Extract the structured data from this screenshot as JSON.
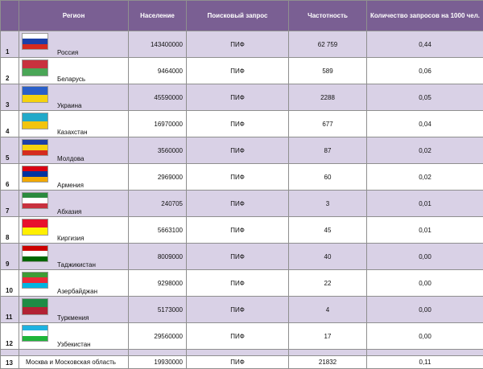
{
  "headers": {
    "num": "",
    "region": "Регион",
    "population": "Население",
    "query": "Поисковый запрос",
    "frequency": "Частотность",
    "per1000": "Количество запросов на 1000 чел."
  },
  "rows": [
    {
      "n": "1",
      "region": "Россия",
      "population": "143400000",
      "query": "ПИФ",
      "frequency": "62 759",
      "per1000": "0,44",
      "flag": "russia-flag-icon",
      "colors": [
        "#ffffff",
        "#1c3fa8",
        "#d52b1e"
      ]
    },
    {
      "n": "2",
      "region": "Беларусь",
      "population": "9464000",
      "query": "ПИФ",
      "frequency": "589",
      "per1000": "0,06",
      "flag": "belarus-flag-icon",
      "colors": [
        "#c8313e",
        "#4aa657"
      ]
    },
    {
      "n": "3",
      "region": "Украина",
      "population": "45590000",
      "query": "ПИФ",
      "frequency": "2288",
      "per1000": "0,05",
      "flag": "ukraine-flag-icon",
      "colors": [
        "#2a5fc9",
        "#f5d20f"
      ]
    },
    {
      "n": "4",
      "region": "Казахстан",
      "population": "16970000",
      "query": "ПИФ",
      "frequency": "677",
      "per1000": "0,04",
      "flag": "kazakhstan-flag-icon",
      "colors": [
        "#21a9c9",
        "#f1c40f"
      ]
    },
    {
      "n": "5",
      "region": "Молдова",
      "population": "3560000",
      "query": "ПИФ",
      "frequency": "87",
      "per1000": "0,02",
      "flag": "moldova-flag-icon",
      "colors": [
        "#1c3fa8",
        "#f5d20f",
        "#d52b1e"
      ]
    },
    {
      "n": "6",
      "region": "Армения",
      "population": "2969000",
      "query": "ПИФ",
      "frequency": "60",
      "per1000": "0,02",
      "flag": "armenia-flag-icon",
      "colors": [
        "#d90012",
        "#0033a0",
        "#f2a800"
      ]
    },
    {
      "n": "7",
      "region": "Абхазия",
      "population": "240705",
      "query": "ПИФ",
      "frequency": "3",
      "per1000": "0,01",
      "flag": "abkhazia-flag-icon",
      "colors": [
        "#2b8a3e",
        "#ffffff",
        "#c8313e"
      ]
    },
    {
      "n": "8",
      "region": "Киргизия",
      "population": "5663100",
      "query": "ПИФ",
      "frequency": "45",
      "per1000": "0,01",
      "flag": "kyrgyzstan-flag-icon",
      "colors": [
        "#e8112d",
        "#ffef00"
      ]
    },
    {
      "n": "9",
      "region": "Таджикистан",
      "population": "8009000",
      "query": "ПИФ",
      "frequency": "40",
      "per1000": "0,00",
      "flag": "tajikistan-flag-icon",
      "colors": [
        "#cc0000",
        "#ffffff",
        "#006600"
      ]
    },
    {
      "n": "10",
      "region": "Азербайджан",
      "population": "9298000",
      "query": "ПИФ",
      "frequency": "22",
      "per1000": "0,00",
      "flag": "azerbaijan-flag-icon",
      "colors": [
        "#3f9c35",
        "#ed2939",
        "#00b5e2"
      ]
    },
    {
      "n": "11",
      "region": "Туркмения",
      "population": "5173000",
      "query": "ПИФ",
      "frequency": "4",
      "per1000": "0,00",
      "flag": "turkmenistan-flag-icon",
      "colors": [
        "#1e8c45",
        "#b22234"
      ]
    },
    {
      "n": "12",
      "region": "Узбекистан",
      "population": "29560000",
      "query": "ПИФ",
      "frequency": "17",
      "per1000": "0,00",
      "flag": "uzbekistan-flag-icon",
      "colors": [
        "#1eb2e0",
        "#ffffff",
        "#1eb53a"
      ]
    },
    {
      "n": "13",
      "region": "Москва и Московская область",
      "population": "19930000",
      "query": "ПИФ",
      "frequency": "21832",
      "per1000": "0,11",
      "flag": "",
      "colors": []
    }
  ]
}
